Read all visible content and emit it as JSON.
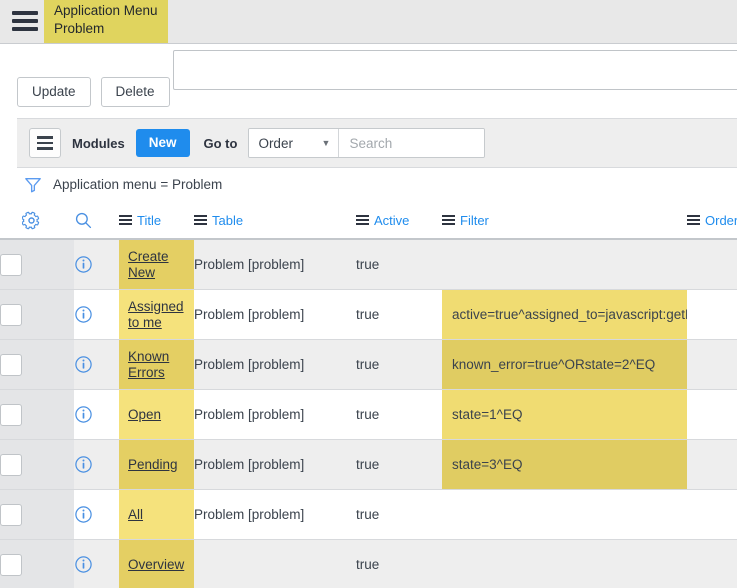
{
  "topbar": {
    "hamburger_icon": "hamburger-icon",
    "app_menu": {
      "line1": "Application Menu",
      "line2": "Problem"
    }
  },
  "actions": {
    "update_label": "Update",
    "delete_label": "Delete"
  },
  "goto_bar": {
    "modules_icon": "hamburger-icon",
    "modules_label": "Modules",
    "new_label": "New",
    "goto_label": "Go to",
    "select_value": "Order",
    "caret_icon": "chevron-down-icon",
    "search_placeholder": "Search",
    "search_value": ""
  },
  "breadcrumb": {
    "funnel_icon": "funnel-icon",
    "text": "Application menu = Problem"
  },
  "table": {
    "gear_icon": "gear-icon",
    "search_icon": "search-icon",
    "columns": [
      {
        "key": "title",
        "label": "Title"
      },
      {
        "key": "table",
        "label": "Table"
      },
      {
        "key": "active",
        "label": "Active"
      },
      {
        "key": "filter",
        "label": "Filter"
      },
      {
        "key": "order",
        "label": "Order"
      }
    ],
    "rows": [
      {
        "title": "Create New",
        "table": "Problem [problem]",
        "active": "true",
        "filter": "",
        "order": "",
        "title_highlighted": true,
        "filter_highlighted": false
      },
      {
        "title": "Assigned to me",
        "table": "Problem [problem]",
        "active": "true",
        "filter": "active=true^assigned_to=javascript:getMy...",
        "order": "",
        "title_highlighted": true,
        "filter_highlighted": true
      },
      {
        "title": "Known Errors",
        "table": "Problem [problem]",
        "active": "true",
        "filter": "known_error=true^ORstate=2^EQ",
        "order": "",
        "title_highlighted": true,
        "filter_highlighted": true
      },
      {
        "title": "Open",
        "table": "Problem [problem]",
        "active": "true",
        "filter": "state=1^EQ",
        "order": "",
        "title_highlighted": true,
        "filter_highlighted": true
      },
      {
        "title": "Pending",
        "table": "Problem [problem]",
        "active": "true",
        "filter": "state=3^EQ",
        "order": "",
        "title_highlighted": true,
        "filter_highlighted": true
      },
      {
        "title": "All",
        "table": "Problem [problem]",
        "active": "true",
        "filter": "",
        "order": "",
        "title_highlighted": true,
        "filter_highlighted": false
      },
      {
        "title": "Overview",
        "table": "",
        "active": "true",
        "filter": "",
        "order": "",
        "title_highlighted": true,
        "filter_highlighted": false
      }
    ]
  },
  "colors": {
    "accent_blue": "#1f8ced",
    "highlight_yellow": "#f5e27c",
    "highlight_yellow_alt": "#e4cf63",
    "chip_yellow": "#e0d45e",
    "topbar_gray": "#e8e8e8",
    "row_alt_gray": "#eeeeee"
  }
}
